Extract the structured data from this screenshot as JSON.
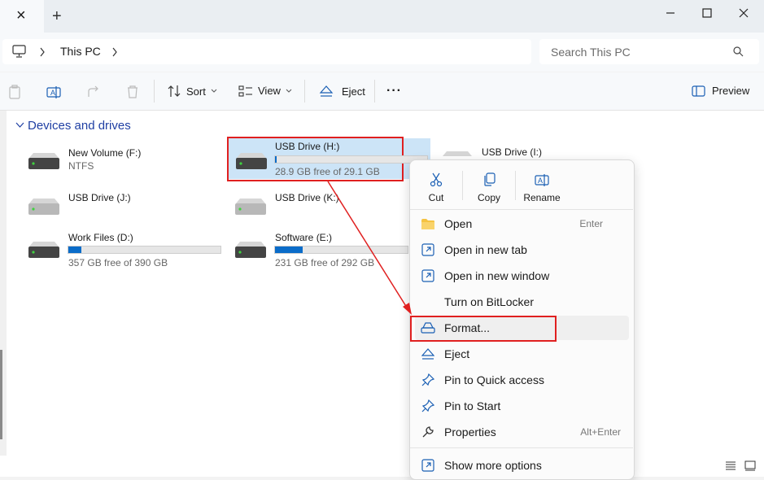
{
  "window": {
    "new_tab": "+",
    "close_tab": "×"
  },
  "address": {
    "crumb": "This PC"
  },
  "search": {
    "placeholder": "Search This PC"
  },
  "toolbar": {
    "sort": "Sort",
    "view": "View",
    "eject": "Eject",
    "more": "···",
    "preview": "Preview"
  },
  "section": {
    "title": "Devices and drives"
  },
  "drives": [
    {
      "name": "New Volume (F:)",
      "sub": "NTFS"
    },
    {
      "name": "USB Drive (H:)",
      "sub": "28.9 GB free of 29.1 GB",
      "used_fraction": 0.007
    },
    {
      "name": "USB Drive (I:)"
    },
    {
      "name": "USB Drive (J:)"
    },
    {
      "name": "USB Drive (K:)"
    },
    {
      "name": "Work Files (D:)",
      "sub": "357 GB free of 390 GB",
      "used_fraction": 0.085
    },
    {
      "name": "Software (E:)",
      "sub": "231 GB free of 292 GB",
      "used_fraction": 0.21
    }
  ],
  "menu": {
    "quick": [
      {
        "label": "Cut",
        "icon": "cut-icon"
      },
      {
        "label": "Copy",
        "icon": "copy-icon"
      },
      {
        "label": "Rename",
        "icon": "rename-icon"
      }
    ],
    "items": [
      {
        "label": "Open",
        "shortcut": "Enter",
        "icon": "folder-icon"
      },
      {
        "label": "Open in new tab",
        "icon": "new-tab-icon"
      },
      {
        "label": "Open in new window",
        "icon": "new-window-icon"
      },
      {
        "label": "Turn on BitLocker"
      },
      {
        "label": "Format...",
        "icon": "format-icon"
      },
      {
        "label": "Eject",
        "icon": "eject-icon"
      },
      {
        "label": "Pin to Quick access",
        "icon": "pin-icon"
      },
      {
        "label": "Pin to Start",
        "icon": "pin-icon"
      },
      {
        "label": "Properties",
        "shortcut": "Alt+Enter",
        "icon": "wrench-icon"
      },
      {
        "label": "Show more options",
        "icon": "more-options-icon"
      }
    ]
  },
  "colors": {
    "accent": "#0a6cc9",
    "highlight": "#e02020",
    "section": "#1f3fa3"
  }
}
